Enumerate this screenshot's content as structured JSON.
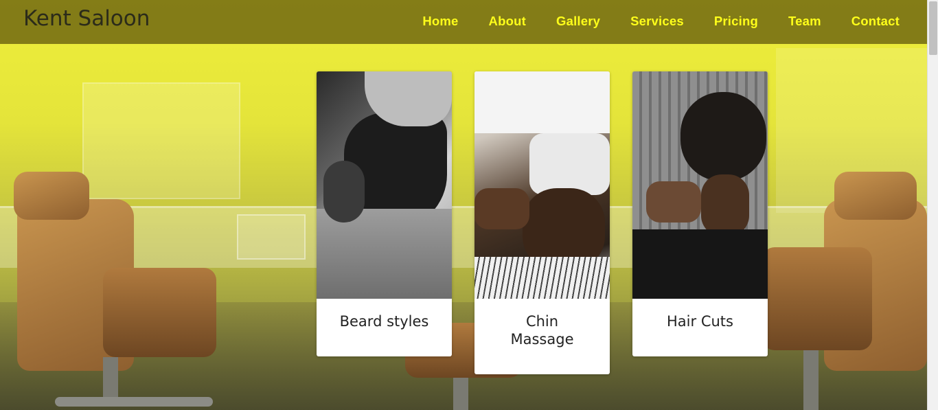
{
  "brand": {
    "name": "Kent Saloon"
  },
  "nav": {
    "items": [
      {
        "label": "Home"
      },
      {
        "label": "About"
      },
      {
        "label": "Gallery"
      },
      {
        "label": "Services"
      },
      {
        "label": "Pricing"
      },
      {
        "label": "Team"
      },
      {
        "label": "Contact"
      }
    ]
  },
  "services": [
    {
      "title": "Beard styles",
      "image": "beard-styling-photo"
    },
    {
      "title": "Chin Massage",
      "image": "chin-massage-photo"
    },
    {
      "title": "Hair Cuts",
      "image": "hair-cut-photo"
    }
  ],
  "colors": {
    "nav_link": "#ffff1a",
    "header_bg": "#5a500a",
    "hero_overlay": "#efef3a"
  }
}
